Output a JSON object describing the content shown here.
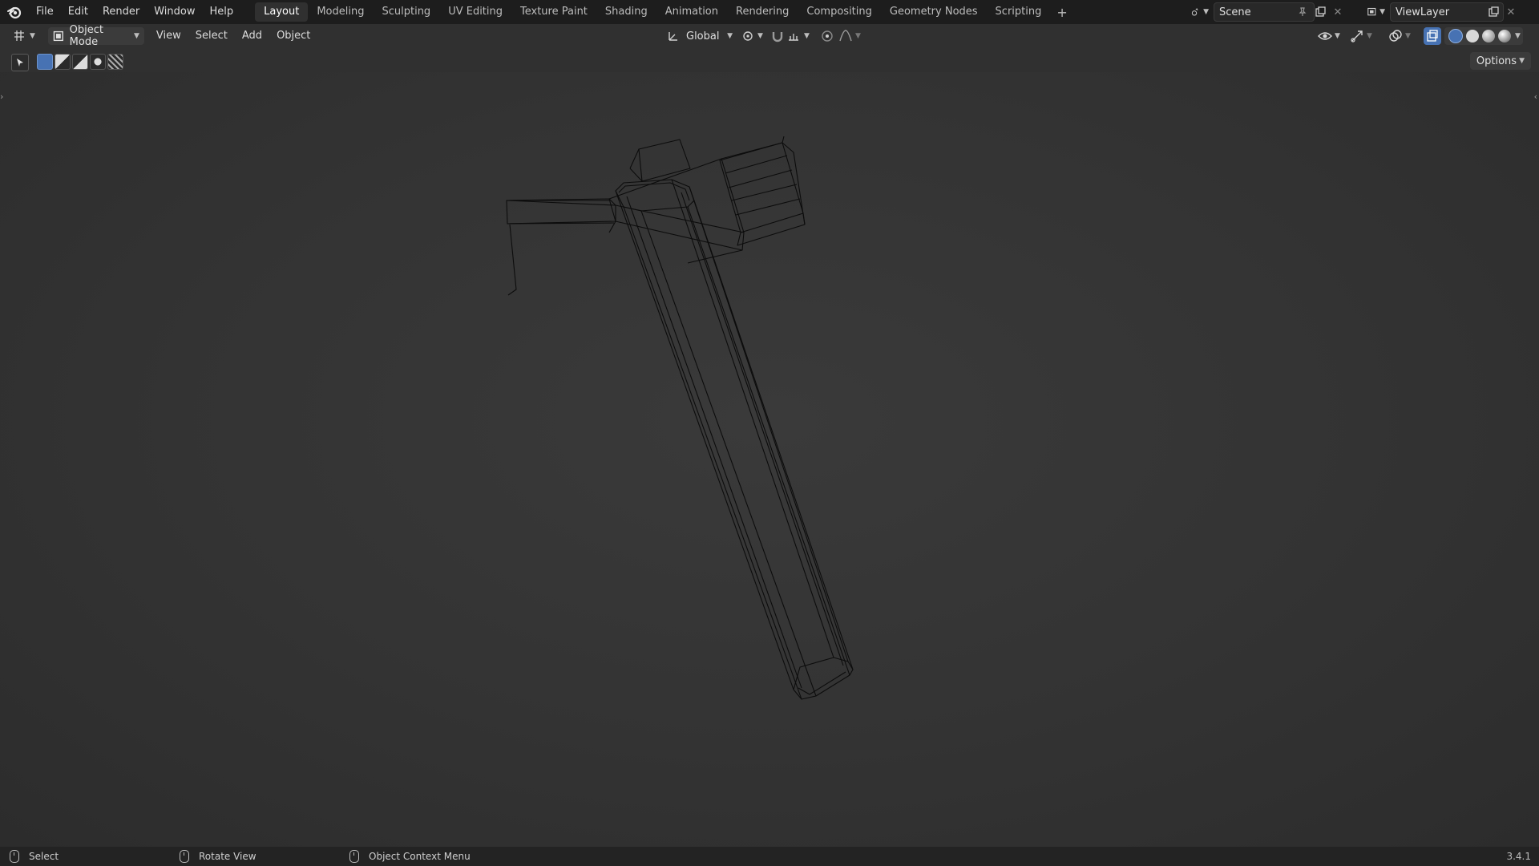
{
  "topbar": {
    "menus": [
      "File",
      "Edit",
      "Render",
      "Window",
      "Help"
    ],
    "workspaces": [
      "Layout",
      "Modeling",
      "Sculpting",
      "UV Editing",
      "Texture Paint",
      "Shading",
      "Animation",
      "Rendering",
      "Compositing",
      "Geometry Nodes",
      "Scripting"
    ],
    "active_workspace": "Layout",
    "add_workspace": "+",
    "scene": "Scene",
    "view_layer": "ViewLayer"
  },
  "header": {
    "mode": "Object Mode",
    "menus": [
      "View",
      "Select",
      "Add",
      "Object"
    ],
    "orientation": "Global",
    "options": "Options"
  },
  "status": {
    "select": "Select",
    "rotate": "Rotate View",
    "context": "Object Context Menu",
    "version": "3.4.1"
  },
  "colors": {
    "topbar": "#1d1d1d",
    "viewport": "#303030",
    "accent": "#4772b3",
    "wire": "#0c0c0c"
  }
}
